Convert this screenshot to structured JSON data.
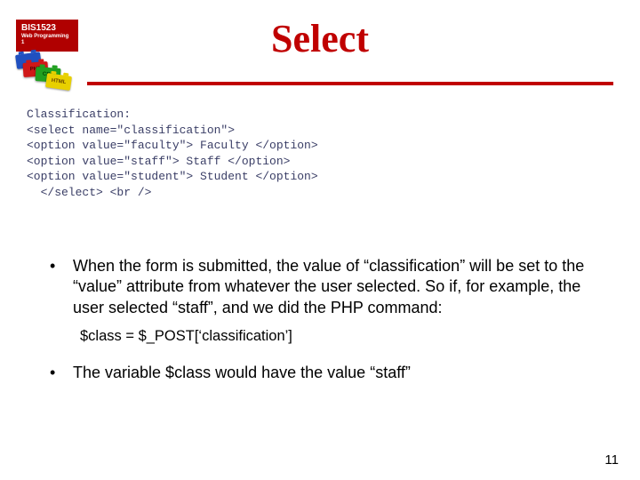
{
  "course": {
    "code": "BIS1523",
    "subtitle": "Web Programming 1"
  },
  "title": "Select",
  "code_lines": [
    "Classification:",
    "<select name=\"classification\">",
    "<option value=\"faculty\"> Faculty </option>",
    "<option value=\"staff\"> Staff </option>",
    "<option value=\"student\"> Student </option>",
    "  </select> <br />"
  ],
  "blocks": {
    "red": "PHP",
    "green": "CSS",
    "yellow": "HTML"
  },
  "bullets": [
    {
      "text": "When the form is submitted, the value of “classification” will be set to the “value” attribute from whatever the user selected.  So if, for example, the user selected “staff”, and we did the PHP command:",
      "sub": "$class = $_POST[‘classification’]"
    },
    {
      "text": "The variable $class would have the value “staff”"
    }
  ],
  "page_number": "11"
}
